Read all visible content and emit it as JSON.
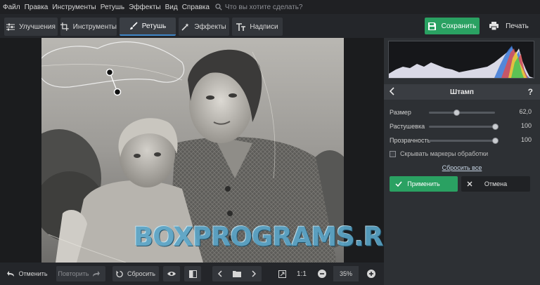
{
  "menu": {
    "items": [
      "Файл",
      "Правка",
      "Инструменты",
      "Ретушь",
      "Эффекты",
      "Вид",
      "Справка"
    ],
    "search_placeholder": "Что вы хотите сделать?"
  },
  "tabs": [
    {
      "label": "Улучшения",
      "icon": "sliders-icon"
    },
    {
      "label": "Инструменты",
      "icon": "crop-icon"
    },
    {
      "label": "Ретушь",
      "icon": "brush-icon",
      "active": true
    },
    {
      "label": "Эффекты",
      "icon": "magic-wand-icon"
    },
    {
      "label": "Надписи",
      "icon": "text-icon"
    }
  ],
  "toolbar": {
    "save_label": "Сохранить",
    "print_label": "Печать"
  },
  "panel": {
    "tool_title": "Штамп",
    "help": "?",
    "sliders": [
      {
        "label": "Размер",
        "value": "62,0",
        "level": 0.42
      },
      {
        "label": "Растушевка",
        "value": "100",
        "level": 1.0
      },
      {
        "label": "Прозрачность",
        "value": "100",
        "level": 1.0
      }
    ],
    "hide_markers_label": "Скрывать маркеры обработки",
    "reset_all_label": "Сбросить все",
    "apply_label": "Применить",
    "cancel_label": "Отмена"
  },
  "bottom": {
    "undo_label": "Отменить",
    "redo_label": "Повторить",
    "reset_label": "Сбросить",
    "zoom_1to1": "1:1",
    "zoom_value": "35%"
  },
  "watermark": "BOXPROGRAMS.RU",
  "colors": {
    "accent_green": "#2aa162",
    "active_tab_underline": "#3f86c8"
  }
}
